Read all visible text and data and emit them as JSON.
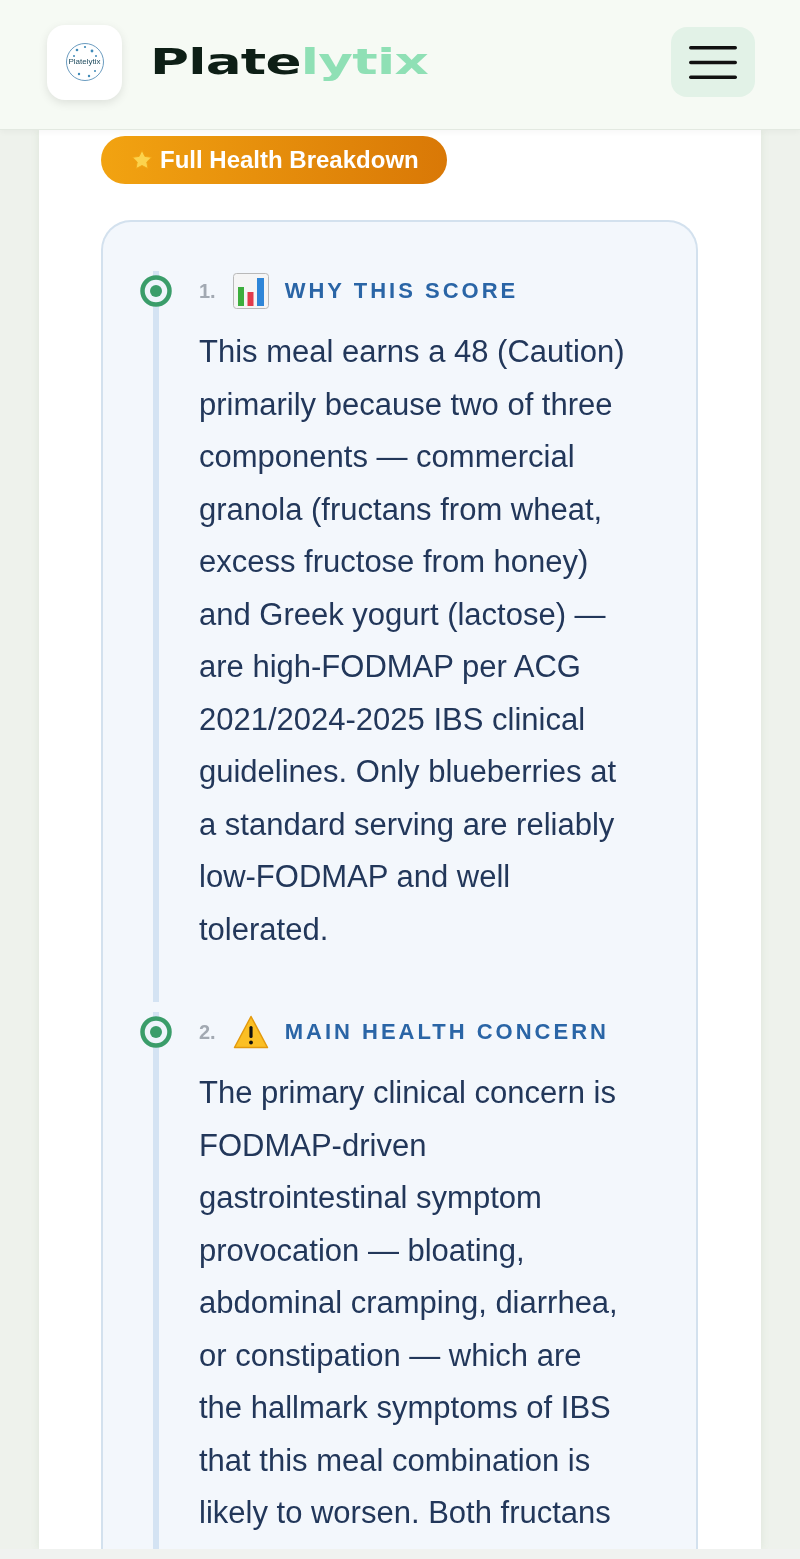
{
  "header": {
    "logo": {
      "text": "Platelytix"
    },
    "wordmark": {
      "dark": "Plate",
      "light": "lytix"
    }
  },
  "badge": {
    "label": "Full Health Breakdown"
  },
  "sections": [
    {
      "kind": "chart",
      "number": "1.",
      "title": "WHY THIS SCORE",
      "body": "This meal earns a 48 (Caution) primarily because two of three components — commercial granola (fructans from wheat, excess fructose from honey) and Greek yogurt (lactose) — are high-FODMAP per ACG 2021/2024-2025 IBS clinical guidelines. Only blueberries at a standard serving are reliably low-FODMAP and well tolerated."
    },
    {
      "kind": "warning",
      "number": "2.",
      "title": "MAIN HEALTH CONCERN",
      "body": "The primary clinical concern is FODMAP-driven gastrointestinal symptom provocation — bloating, abdominal cramping, diarrhea, or constipation — which are the hallmark symptoms of IBS that this meal combination is likely to worsen. Both fructans"
    }
  ]
}
